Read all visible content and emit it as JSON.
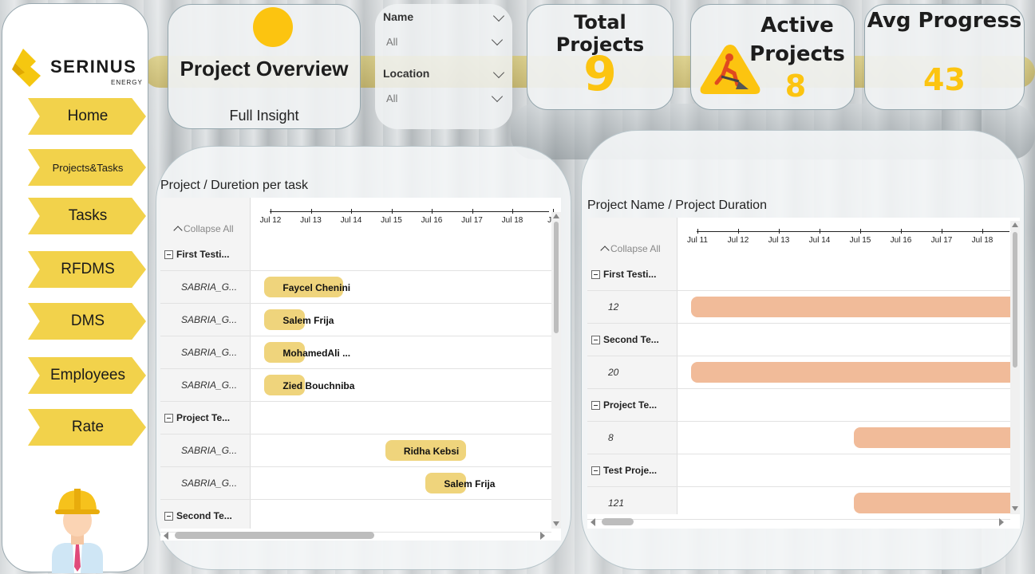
{
  "brand": {
    "name": "SERINUS",
    "sub": "ENERGY",
    "logo_icon": "serinus-flame-logo",
    "accent": "#fcc410"
  },
  "nav": {
    "items": [
      {
        "label": "Home",
        "name": "nav-home"
      },
      {
        "label": "Projects&Tasks",
        "name": "nav-projects-tasks"
      },
      {
        "label": "Tasks",
        "name": "nav-tasks"
      },
      {
        "label": "RFDMS",
        "name": "nav-rfdms"
      },
      {
        "label": "DMS",
        "name": "nav-dms"
      },
      {
        "label": "Employees",
        "name": "nav-employees"
      },
      {
        "label": "Rate",
        "name": "nav-rate"
      }
    ],
    "button_color": "#f2d24b"
  },
  "overview": {
    "title": "Project Overview",
    "subtitle": "Full Insight"
  },
  "filters": [
    {
      "label": "Name",
      "value": "All"
    },
    {
      "label": "Location",
      "value": "All"
    }
  ],
  "kpis": {
    "total": {
      "title": "Total Projects",
      "value": "9"
    },
    "active": {
      "title": "Active Projects",
      "value": "8",
      "icon": "construction-worker-warning-icon"
    },
    "progress": {
      "title": "Avg Progress",
      "value": "43"
    }
  },
  "gantt_tasks": {
    "title": "Project / Duretion per task",
    "collapse_label": "Collapse All",
    "ticks": [
      "Jul 12",
      "Jul 13",
      "Jul 14",
      "Jul 15",
      "Jul 16",
      "Jul 17",
      "Jul 18",
      "Jul"
    ],
    "rows": [
      {
        "type": "group",
        "label": "First Testi..."
      },
      {
        "type": "child",
        "label": "SABRIA_G...",
        "bar_label": "Faycel Chenini"
      },
      {
        "type": "child",
        "label": "SABRIA_G...",
        "bar_label": "Salem Frija"
      },
      {
        "type": "child",
        "label": "SABRIA_G...",
        "bar_label": "MohamedAli ..."
      },
      {
        "type": "child",
        "label": "SABRIA_G...",
        "bar_label": "Zied Bouchniba"
      },
      {
        "type": "group",
        "label": "Project Te..."
      },
      {
        "type": "child",
        "label": "SABRIA_G...",
        "bar_label": "Ridha Kebsi"
      },
      {
        "type": "child",
        "label": "SABRIA_G...",
        "bar_label": "Salem Frija"
      },
      {
        "type": "group",
        "label": "Second Te..."
      }
    ],
    "bar_color": "#efd47c"
  },
  "gantt_projects": {
    "title": "Project Name / Project Duration",
    "collapse_label": "Collapse All",
    "ticks": [
      "Jul 11",
      "Jul 12",
      "Jul 13",
      "Jul 14",
      "Jul 15",
      "Jul 16",
      "Jul 17",
      "Jul 18"
    ],
    "rows": [
      {
        "type": "group",
        "label": "First Testi..."
      },
      {
        "type": "child",
        "label": "12"
      },
      {
        "type": "group",
        "label": "Second Te..."
      },
      {
        "type": "child",
        "label": "20"
      },
      {
        "type": "group",
        "label": "Project Te..."
      },
      {
        "type": "child",
        "label": "8"
      },
      {
        "type": "group",
        "label": "Test Proje..."
      },
      {
        "type": "child",
        "label": "121"
      }
    ],
    "bar_color": "#f1bb99"
  }
}
